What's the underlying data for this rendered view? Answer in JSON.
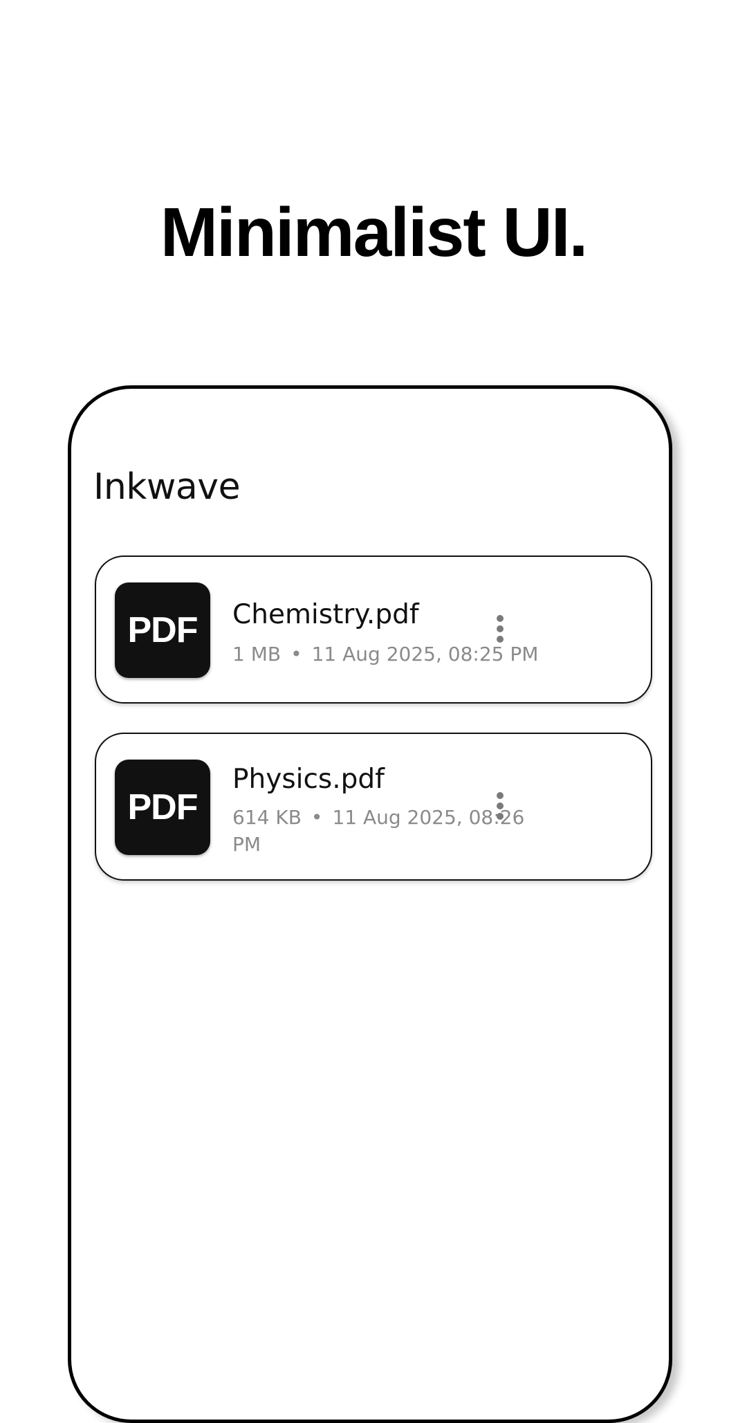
{
  "headline": "Minimalist UI.",
  "app": {
    "title": "Inkwave"
  },
  "files": [
    {
      "thumb_label": "PDF",
      "name": "Chemistry.pdf",
      "size": "1 MB",
      "separator": "•",
      "date": "11 Aug 2025, 08:25 PM",
      "menu_icon": "more-vertical-icon"
    },
    {
      "thumb_label": "PDF",
      "name": "Physics.pdf",
      "size": "614 KB",
      "separator": "•",
      "date": "11 Aug 2025, 08:26 PM",
      "menu_icon": "more-vertical-icon"
    }
  ],
  "colors": {
    "background": "#ffffff",
    "text": "#111111",
    "meta_text": "#8a8a8a",
    "thumb_bg": "#111111",
    "frame": "#000000"
  }
}
